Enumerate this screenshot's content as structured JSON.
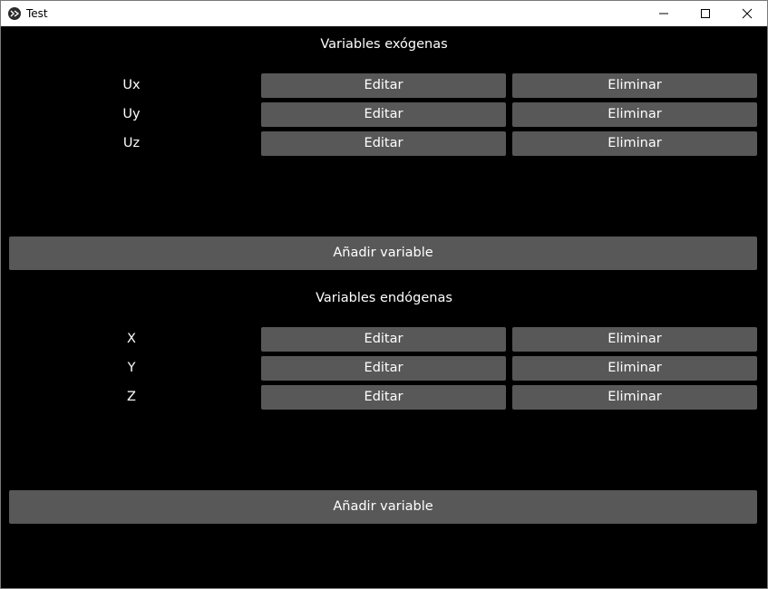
{
  "window": {
    "title": "Test",
    "icons": {
      "app": "kivy-logo-icon",
      "minimize": "minimize-icon",
      "maximize": "maximize-icon",
      "close": "close-icon"
    }
  },
  "exogenous": {
    "title": "Variables exógenas",
    "rows": [
      {
        "name": "Ux",
        "edit_label": "Editar",
        "delete_label": "Eliminar"
      },
      {
        "name": "Uy",
        "edit_label": "Editar",
        "delete_label": "Eliminar"
      },
      {
        "name": "Uz",
        "edit_label": "Editar",
        "delete_label": "Eliminar"
      }
    ],
    "add_label": "Añadir variable"
  },
  "endogenous": {
    "title": "Variables endógenas",
    "rows": [
      {
        "name": "X",
        "edit_label": "Editar",
        "delete_label": "Eliminar"
      },
      {
        "name": "Y",
        "edit_label": "Editar",
        "delete_label": "Eliminar"
      },
      {
        "name": "Z",
        "edit_label": "Editar",
        "delete_label": "Eliminar"
      }
    ],
    "add_label": "Añadir variable"
  },
  "colors": {
    "background": "#000000",
    "button": "#585858",
    "text": "#ffffff",
    "titlebar": "#ffffff"
  }
}
